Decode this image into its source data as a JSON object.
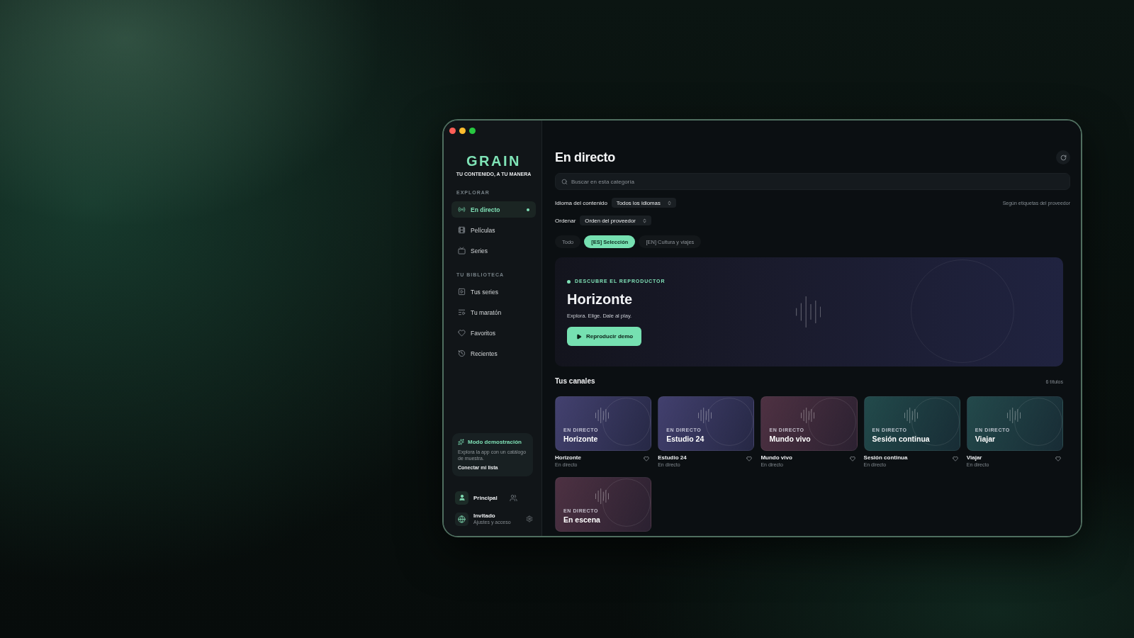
{
  "sidebar": {
    "logo": "GRAIN",
    "tagline": "TU CONTENIDO, A TU MANERA",
    "sections": [
      {
        "heading": "EXPLORAR",
        "items": [
          {
            "label": "En directo",
            "selected": true
          },
          {
            "label": "Películas",
            "selected": false
          },
          {
            "label": "Series",
            "selected": false
          }
        ]
      },
      {
        "heading": "TU BIBLIOTECA",
        "items": [
          {
            "label": "Tus series",
            "selected": false
          },
          {
            "label": "Tu maratón",
            "selected": false
          },
          {
            "label": "Favoritos",
            "selected": false
          },
          {
            "label": "Recientes",
            "selected": false
          }
        ]
      }
    ],
    "demo": {
      "title": "Modo demostración",
      "text": "Explora la app con un catálogo de muestra.",
      "link": "Conectar mi lista"
    },
    "profiles": [
      {
        "kind": "account",
        "name": "Principal"
      },
      {
        "kind": "guest",
        "name": "Invitado",
        "subtitle": "Ajustes y acceso"
      }
    ]
  },
  "main": {
    "title": "En directo",
    "search": {
      "placeholder": "Buscar en esta categoría"
    },
    "filters": [
      {
        "label": "Idioma del contenido",
        "value": "Todos los idiomas"
      },
      {
        "label": "Ordenar",
        "value": "Orden del proveedor"
      }
    ],
    "filter_note": "Según etiquetas del proveedor",
    "chips": [
      {
        "label": "Todo",
        "selected": false
      },
      {
        "label": "[ES] Selección",
        "selected": true
      },
      {
        "label": "[EN] Cultura y viajes",
        "selected": false
      }
    ],
    "hero": {
      "kicker": "DESCUBRE EL REPRODUCTOR",
      "title": "Horizonte",
      "subtitle": "Explora. Elige. Dale al play.",
      "button": "Reproducir demo"
    },
    "channels": {
      "heading": "Tus canales",
      "count": "6 títulos",
      "items": [
        {
          "tag": "EN DIRECTO",
          "title": "Horizonte",
          "name": "Horizonte",
          "status": "En directo",
          "favorite": false,
          "color": "#43416f"
        },
        {
          "tag": "EN DIRECTO",
          "title": "Estudio 24",
          "name": "Estudio 24",
          "status": "En directo",
          "favorite": false,
          "color": "#42406e"
        },
        {
          "tag": "EN DIRECTO",
          "title": "Mundo vivo",
          "name": "Mundo vivo",
          "status": "En directo",
          "favorite": false,
          "color": "#4e3142"
        },
        {
          "tag": "EN DIRECTO",
          "title": "Sesión continua",
          "name": "Sesión continua",
          "status": "En directo",
          "favorite": false,
          "color": "#224a4b"
        },
        {
          "tag": "EN DIRECTO",
          "title": "Viajar",
          "name": "Viajar",
          "status": "En directo",
          "favorite": false,
          "color": "#23494b"
        },
        {
          "tag": "EN DIRECTO",
          "title": "En escena",
          "color": "#4d3142"
        }
      ]
    }
  }
}
